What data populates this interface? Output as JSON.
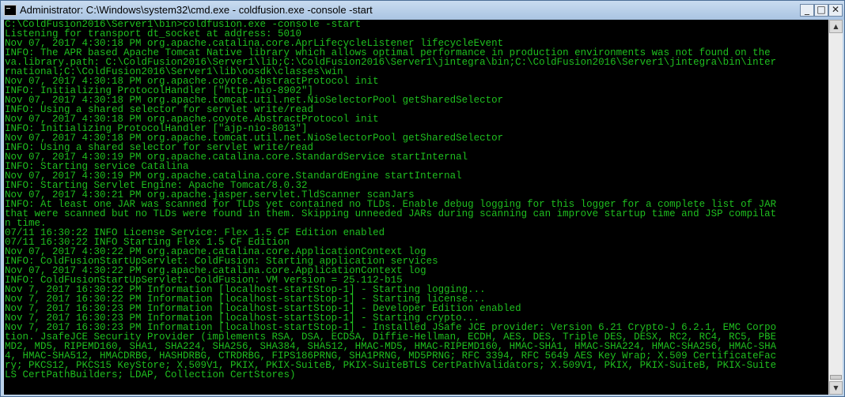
{
  "window": {
    "title": "Administrator: C:\\Windows\\system32\\cmd.exe - coldfusion.exe  -console -start",
    "icon": "cmd-icon",
    "controls": {
      "minimize": "_",
      "maximize": "□",
      "close": "✕"
    }
  },
  "colors": {
    "console_bg": "#000000",
    "console_text": "#1fbf1f"
  },
  "scrollbar": {
    "up": "▲",
    "down": "▼"
  },
  "console_lines": [
    "C:\\ColdFusion2016\\Server1\\bin>coldfusion.exe -console -start",
    "Listening for transport dt_socket at address: 5010",
    "Nov 07, 2017 4:30:18 PM org.apache.catalina.core.AprLifecycleListener lifecycleEvent",
    "INFO: The APR based Apache Tomcat Native library which allows optimal performance in production environments was not found on the",
    "va.library.path: C:\\ColdFusion2016\\Server1\\lib;C:\\ColdFusion2016\\Server1\\jintegra\\bin;C:\\ColdFusion2016\\Server1\\jintegra\\bin\\inter",
    "rnational;C:\\ColdFusion2016\\Server1\\lib\\oosdk\\classes\\win",
    "Nov 07, 2017 4:30:18 PM org.apache.coyote.AbstractProtocol init",
    "INFO: Initializing ProtocolHandler [\"http-nio-8902\"]",
    "Nov 07, 2017 4:30:18 PM org.apache.tomcat.util.net.NioSelectorPool getSharedSelector",
    "INFO: Using a shared selector for servlet write/read",
    "Nov 07, 2017 4:30:18 PM org.apache.coyote.AbstractProtocol init",
    "INFO: Initializing ProtocolHandler [\"ajp-nio-8013\"]",
    "Nov 07, 2017 4:30:18 PM org.apache.tomcat.util.net.NioSelectorPool getSharedSelector",
    "INFO: Using a shared selector for servlet write/read",
    "Nov 07, 2017 4:30:19 PM org.apache.catalina.core.StandardService startInternal",
    "INFO: Starting service Catalina",
    "Nov 07, 2017 4:30:19 PM org.apache.catalina.core.StandardEngine startInternal",
    "INFO: Starting Servlet Engine: Apache Tomcat/8.0.32",
    "Nov 07, 2017 4:30:21 PM org.apache.jasper.servlet.TldScanner scanJars",
    "INFO: At least one JAR was scanned for TLDs yet contained no TLDs. Enable debug logging for this logger for a complete list of JAR",
    "that were scanned but no TLDs were found in them. Skipping unneeded JARs during scanning can improve startup time and JSP compilat",
    "n time.",
    "07/11 16:30:22 INFO License Service: Flex 1.5 CF Edition enabled",
    "07/11 16:30:22 INFO Starting Flex 1.5 CF Edition",
    "Nov 07, 2017 4:30:22 PM org.apache.catalina.core.ApplicationContext log",
    "INFO: ColdFusionStartUpServlet: ColdFusion: Starting application services",
    "Nov 07, 2017 4:30:22 PM org.apache.catalina.core.ApplicationContext log",
    "INFO: ColdFusionStartUpServlet: ColdFusion: VM version = 25.112-b15",
    "Nov 7, 2017 16:30:22 PM Information [localhost-startStop-1] - Starting logging...",
    "Nov 7, 2017 16:30:22 PM Information [localhost-startStop-1] - Starting license...",
    "Nov 7, 2017 16:30:23 PM Information [localhost-startStop-1] - Developer Edition enabled",
    "Nov 7, 2017 16:30:23 PM Information [localhost-startStop-1] - Starting crypto...",
    "Nov 7, 2017 16:30:23 PM Information [localhost-startStop-1] - Installed JSafe JCE provider: Version 6.21 Crypto-J 6.2.1, EMC Corpo",
    "tion. JsafeJCE Security Provider (implements RSA, DSA, ECDSA, Diffie-Hellman, ECDH, AES, DES, Triple DES, DESX, RC2, RC4, RC5, PBE",
    "MD2, MD5, RIPEMD160, SHA1, SHA224, SHA256, SHA384, SHA512, HMAC-MD5, HMAC-RIPEMD160, HMAC-SHA1, HMAC-SHA224, HMAC-SHA256, HMAC-SHA",
    "4, HMAC-SHA512, HMACDRBG, HASHDRBG, CTRDRBG, FIPS186PRNG, SHA1PRNG, MD5PRNG; RFC 3394, RFC 5649 AES Key Wrap; X.509 CertificateFac",
    "ry; PKCS12, PKCS15 KeyStore; X.509V1, PKIX, PKIX-SuiteB, PKIX-SuiteBTLS CertPathValidators; X.509V1, PKIX, PKIX-SuiteB, PKIX-Suite",
    "LS CertPathBuilders; LDAP, Collection CertStores)"
  ]
}
